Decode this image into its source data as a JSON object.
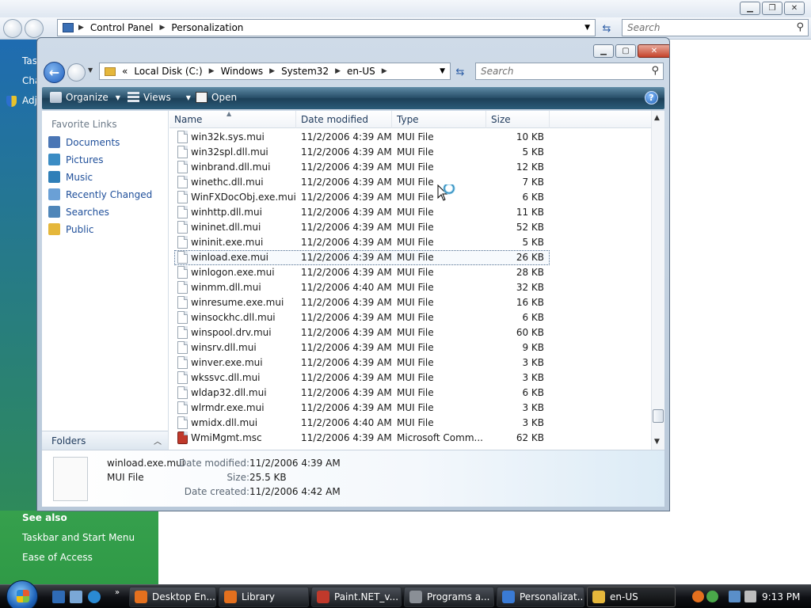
{
  "background_window": {
    "breadcrumbs": [
      "Control Panel",
      "Personalization"
    ],
    "search_placeholder": "Search",
    "left_texts": [
      "Tas",
      "Cha",
      "Adj"
    ],
    "see_also": {
      "heading": "See also",
      "links": [
        "Taskbar and Start Menu",
        "Ease of Access"
      ]
    }
  },
  "explorer": {
    "address": {
      "overflow": "«",
      "breadcrumbs": [
        "Local Disk (C:)",
        "Windows",
        "System32",
        "en-US"
      ]
    },
    "search_placeholder": "Search",
    "toolbar": {
      "organize": "Organize",
      "views": "Views",
      "open": "Open"
    },
    "nav_pane": {
      "header": "Favorite Links",
      "links": [
        {
          "label": "Documents",
          "icon": "documents-icon",
          "color": "#4a76b5"
        },
        {
          "label": "Pictures",
          "icon": "pictures-icon",
          "color": "#3b8cc4"
        },
        {
          "label": "Music",
          "icon": "music-icon",
          "color": "#2f7fb8"
        },
        {
          "label": "Recently Changed",
          "icon": "recent-icon",
          "color": "#6aa0d6"
        },
        {
          "label": "Searches",
          "icon": "searches-icon",
          "color": "#4f86b9"
        },
        {
          "label": "Public",
          "icon": "public-folder-icon",
          "color": "#e5b73b"
        }
      ],
      "folders_label": "Folders"
    },
    "columns": [
      "Name",
      "Date modified",
      "Type",
      "Size"
    ],
    "files": [
      {
        "name": "win32k.sys.mui",
        "date": "11/2/2006 4:39 AM",
        "type": "MUI File",
        "size": "10 KB"
      },
      {
        "name": "win32spl.dll.mui",
        "date": "11/2/2006 4:39 AM",
        "type": "MUI File",
        "size": "5 KB"
      },
      {
        "name": "winbrand.dll.mui",
        "date": "11/2/2006 4:39 AM",
        "type": "MUI File",
        "size": "12 KB"
      },
      {
        "name": "winethc.dll.mui",
        "date": "11/2/2006 4:39 AM",
        "type": "MUI File",
        "size": "7 KB"
      },
      {
        "name": "WinFXDocObj.exe.mui",
        "date": "11/2/2006 4:39 AM",
        "type": "MUI File",
        "size": "6 KB"
      },
      {
        "name": "winhttp.dll.mui",
        "date": "11/2/2006 4:39 AM",
        "type": "MUI File",
        "size": "11 KB"
      },
      {
        "name": "wininet.dll.mui",
        "date": "11/2/2006 4:39 AM",
        "type": "MUI File",
        "size": "52 KB"
      },
      {
        "name": "wininit.exe.mui",
        "date": "11/2/2006 4:39 AM",
        "type": "MUI File",
        "size": "5 KB"
      },
      {
        "name": "winload.exe.mui",
        "date": "11/2/2006 4:39 AM",
        "type": "MUI File",
        "size": "26 KB",
        "selected": true
      },
      {
        "name": "winlogon.exe.mui",
        "date": "11/2/2006 4:39 AM",
        "type": "MUI File",
        "size": "28 KB"
      },
      {
        "name": "winmm.dll.mui",
        "date": "11/2/2006 4:40 AM",
        "type": "MUI File",
        "size": "32 KB"
      },
      {
        "name": "winresume.exe.mui",
        "date": "11/2/2006 4:39 AM",
        "type": "MUI File",
        "size": "16 KB"
      },
      {
        "name": "winsockhc.dll.mui",
        "date": "11/2/2006 4:39 AM",
        "type": "MUI File",
        "size": "6 KB"
      },
      {
        "name": "winspool.drv.mui",
        "date": "11/2/2006 4:39 AM",
        "type": "MUI File",
        "size": "60 KB"
      },
      {
        "name": "winsrv.dll.mui",
        "date": "11/2/2006 4:39 AM",
        "type": "MUI File",
        "size": "9 KB"
      },
      {
        "name": "winver.exe.mui",
        "date": "11/2/2006 4:39 AM",
        "type": "MUI File",
        "size": "3 KB"
      },
      {
        "name": "wkssvc.dll.mui",
        "date": "11/2/2006 4:39 AM",
        "type": "MUI File",
        "size": "3 KB"
      },
      {
        "name": "wldap32.dll.mui",
        "date": "11/2/2006 4:39 AM",
        "type": "MUI File",
        "size": "6 KB"
      },
      {
        "name": "wlrmdr.exe.mui",
        "date": "11/2/2006 4:39 AM",
        "type": "MUI File",
        "size": "3 KB"
      },
      {
        "name": "wmidx.dll.mui",
        "date": "11/2/2006 4:40 AM",
        "type": "MUI File",
        "size": "3 KB"
      },
      {
        "name": "WmiMgmt.msc",
        "date": "11/2/2006 4:39 AM",
        "type": "Microsoft Comm...",
        "size": "62 KB",
        "icon": "msc"
      }
    ],
    "details": {
      "name": "winload.exe.mui",
      "type": "MUI File",
      "date_modified_label": "Date modified:",
      "date_modified": "11/2/2006 4:39 AM",
      "size_label": "Size:",
      "size": "25.5 KB",
      "date_created_label": "Date created:",
      "date_created": "11/2/2006 4:42 AM"
    }
  },
  "taskbar": {
    "buttons": [
      {
        "label": "Desktop En...",
        "icon": "firefox-icon",
        "color": "#e4701e"
      },
      {
        "label": "Library",
        "icon": "firefox-icon",
        "color": "#e4701e"
      },
      {
        "label": "Paint.NET_v...",
        "icon": "paintnet-icon",
        "color": "#c0392b"
      },
      {
        "label": "Programs a...",
        "icon": "programs-icon",
        "color": "#8a8f96"
      },
      {
        "label": "Personalizat...",
        "icon": "personalization-icon",
        "color": "#3a7bd5"
      },
      {
        "label": "en-US",
        "icon": "folder-icon",
        "color": "#e5b73b",
        "active": true
      }
    ],
    "clock": "9:13 PM"
  }
}
